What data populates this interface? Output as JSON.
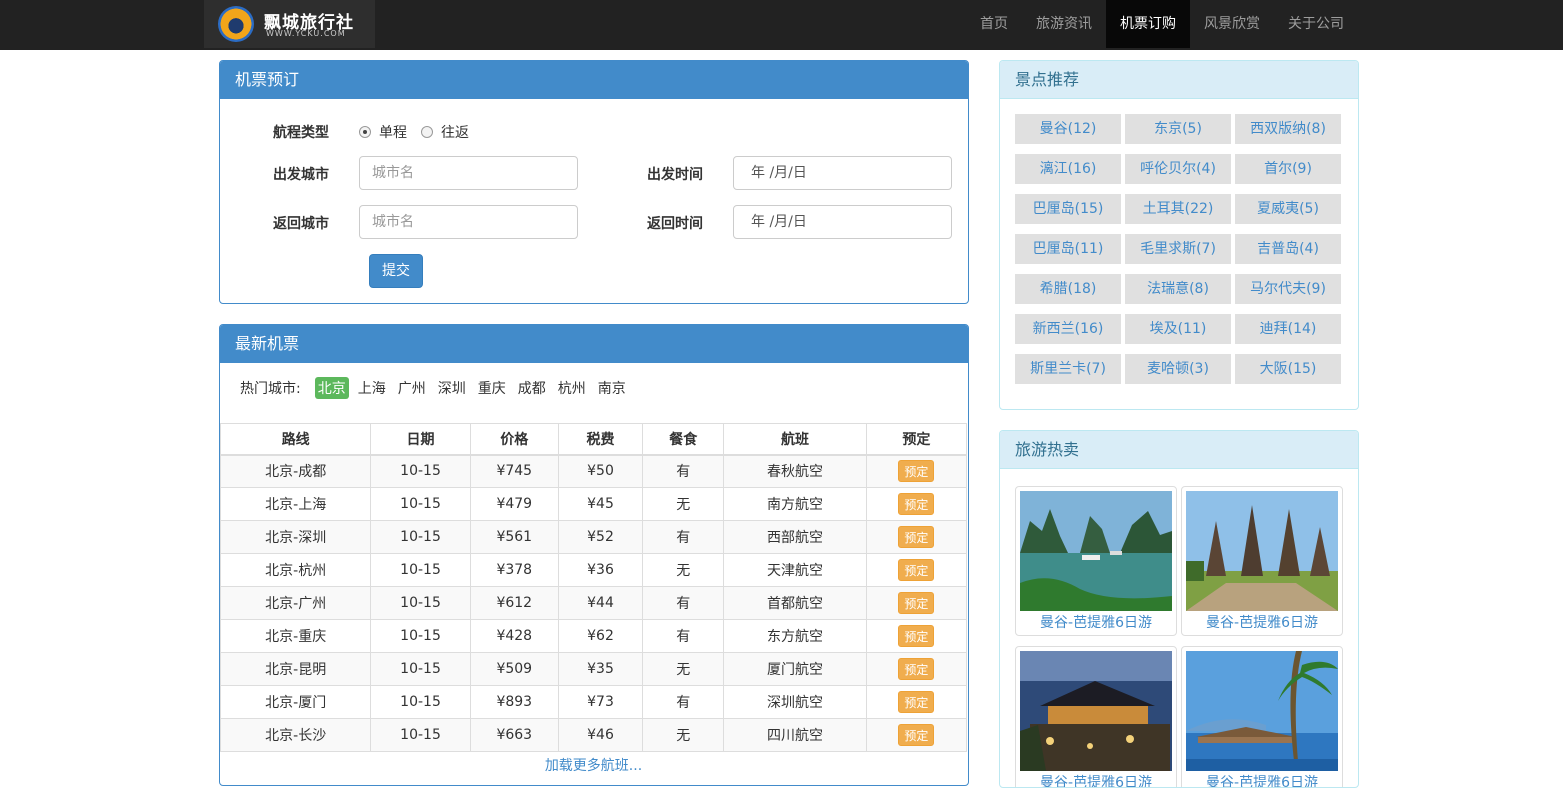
{
  "nav": {
    "logo_title": "飘城旅行社",
    "logo_sub": "WWW.YCKU.COM",
    "items": [
      {
        "label": "首页",
        "active": false
      },
      {
        "label": "旅游资讯",
        "active": false
      },
      {
        "label": "机票订购",
        "active": true
      },
      {
        "label": "风景欣赏",
        "active": false
      },
      {
        "label": "关于公司",
        "active": false
      }
    ]
  },
  "booking": {
    "title": "机票预订",
    "trip_type_label": "航程类型",
    "one_way": "单程",
    "round_trip": "往返",
    "depart_city_label": "出发城市",
    "depart_city_placeholder": "城市名",
    "return_city_label": "返回城市",
    "return_city_placeholder": "城市名",
    "depart_time_label": "出发时间",
    "depart_time_value": "年 /月/日",
    "return_time_label": "返回时间",
    "return_time_value": "年 /月/日",
    "submit": "提交"
  },
  "latest": {
    "title": "最新机票",
    "hot_label": "热门城市:",
    "cities": [
      "北京",
      "上海",
      "广州",
      "深圳",
      "重庆",
      "成都",
      "杭州",
      "南京"
    ],
    "active_city": "北京",
    "columns": [
      "路线",
      "日期",
      "价格",
      "税费",
      "餐食",
      "航班",
      "预定"
    ],
    "book_label": "预定",
    "rows": [
      [
        "北京-成都",
        "10-15",
        "¥745",
        "¥50",
        "有",
        "春秋航空"
      ],
      [
        "北京-上海",
        "10-15",
        "¥479",
        "¥45",
        "无",
        "南方航空"
      ],
      [
        "北京-深圳",
        "10-15",
        "¥561",
        "¥52",
        "有",
        "西部航空"
      ],
      [
        "北京-杭州",
        "10-15",
        "¥378",
        "¥36",
        "无",
        "天津航空"
      ],
      [
        "北京-广州",
        "10-15",
        "¥612",
        "¥44",
        "有",
        "首都航空"
      ],
      [
        "北京-重庆",
        "10-15",
        "¥428",
        "¥62",
        "有",
        "东方航空"
      ],
      [
        "北京-昆明",
        "10-15",
        "¥509",
        "¥35",
        "无",
        "厦门航空"
      ],
      [
        "北京-厦门",
        "10-15",
        "¥893",
        "¥73",
        "有",
        "深圳航空"
      ],
      [
        "北京-长沙",
        "10-15",
        "¥663",
        "¥46",
        "无",
        "四川航空"
      ]
    ],
    "load_more": "加载更多航班..."
  },
  "spots": {
    "title": "景点推荐",
    "items": [
      "曼谷(12)",
      "东京(5)",
      "西双版纳(8)",
      "漓江(16)",
      "呼伦贝尔(4)",
      "首尔(9)",
      "巴厘岛(15)",
      "土耳其(22)",
      "夏威夷(5)",
      "巴厘岛(11)",
      "毛里求斯(7)",
      "吉普岛(4)",
      "希腊(18)",
      "法瑞意(8)",
      "马尔代夫(9)",
      "新西兰(16)",
      "埃及(11)",
      "迪拜(14)",
      "斯里兰卡(7)",
      "麦哈顿(3)",
      "大阪(15)"
    ]
  },
  "hot_sale": {
    "title": "旅游热卖",
    "items": [
      {
        "caption": "曼谷-芭提雅6日游",
        "scene": "bay"
      },
      {
        "caption": "曼谷-芭提雅6日游",
        "scene": "temple"
      },
      {
        "caption": "曼谷-芭提雅6日游",
        "scene": "night"
      },
      {
        "caption": "曼谷-芭提雅6日游",
        "scene": "beach"
      }
    ]
  },
  "colors": {
    "primary": "#428bca",
    "warning": "#f0ad4e",
    "success": "#5cb85c",
    "navbar": "#222222"
  }
}
